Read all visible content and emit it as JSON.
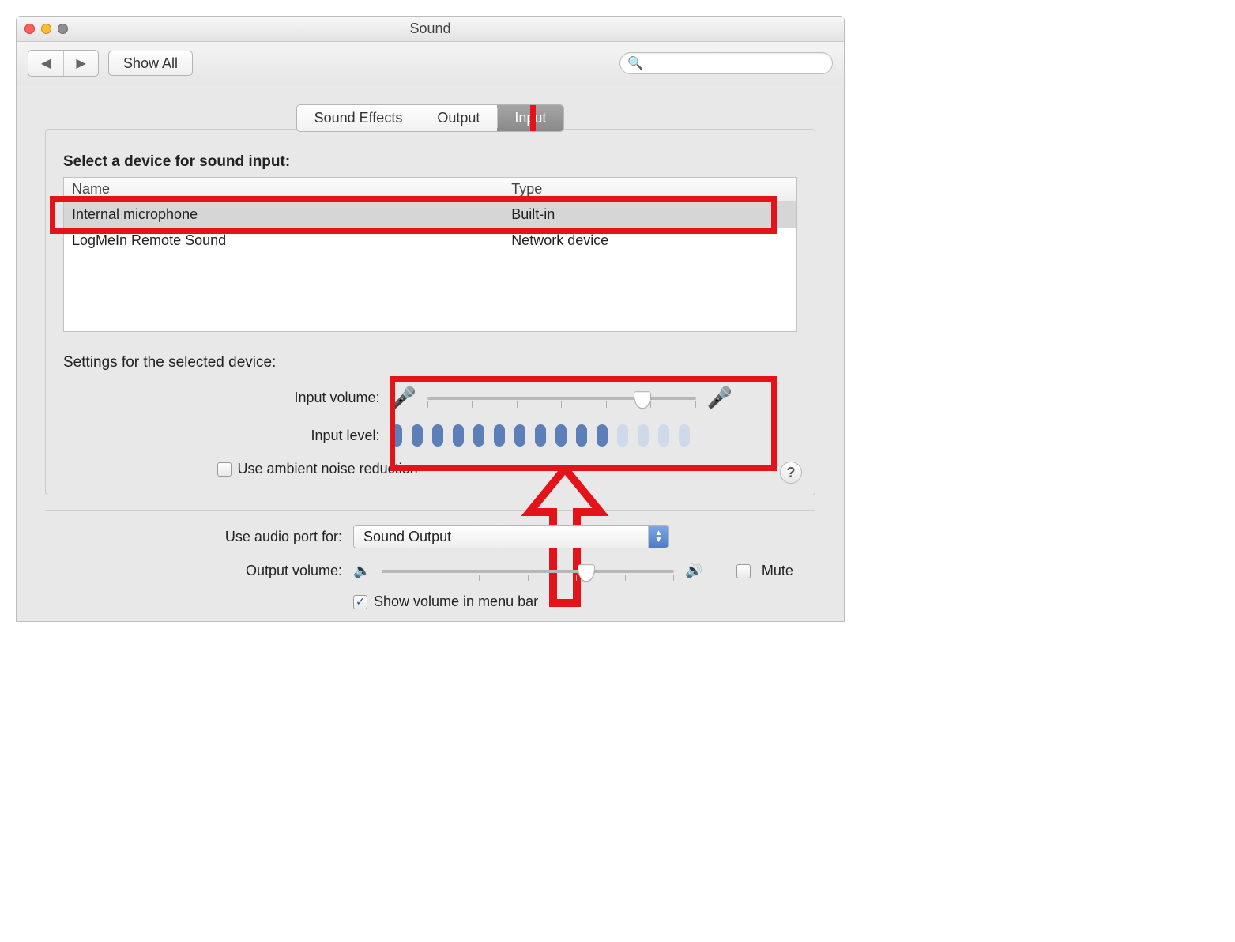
{
  "window": {
    "title": "Sound"
  },
  "toolbar": {
    "show_all": "Show All",
    "search_placeholder": ""
  },
  "tabs": [
    "Sound Effects",
    "Output",
    "Input"
  ],
  "active_tab_index": 2,
  "input": {
    "section_title": "Select a device for sound input:",
    "columns": {
      "name": "Name",
      "type": "Type"
    },
    "devices": [
      {
        "name": "Internal microphone",
        "type": "Built-in",
        "selected": true
      },
      {
        "name": "LogMeIn Remote Sound",
        "type": "Network device",
        "selected": false
      }
    ],
    "settings_label": "Settings for the selected device:",
    "input_volume_label": "Input volume:",
    "input_volume_percent": 80,
    "input_level_label": "Input level:",
    "input_level_segments_total": 15,
    "input_level_segments_active": 11,
    "ambient_label": "Use ambient noise reduction",
    "ambient_checked": false
  },
  "audio_port": {
    "label": "Use audio port for:",
    "selected": "Sound Output"
  },
  "output": {
    "label": "Output volume:",
    "percent": 70,
    "mute_label": "Mute",
    "mute_checked": false
  },
  "menu_bar": {
    "label": "Show volume in menu bar",
    "checked": true
  },
  "annotations": {
    "highlight_tab": "Input",
    "highlight_device": "Internal microphone",
    "highlight_sliders": true,
    "arrow": true
  }
}
